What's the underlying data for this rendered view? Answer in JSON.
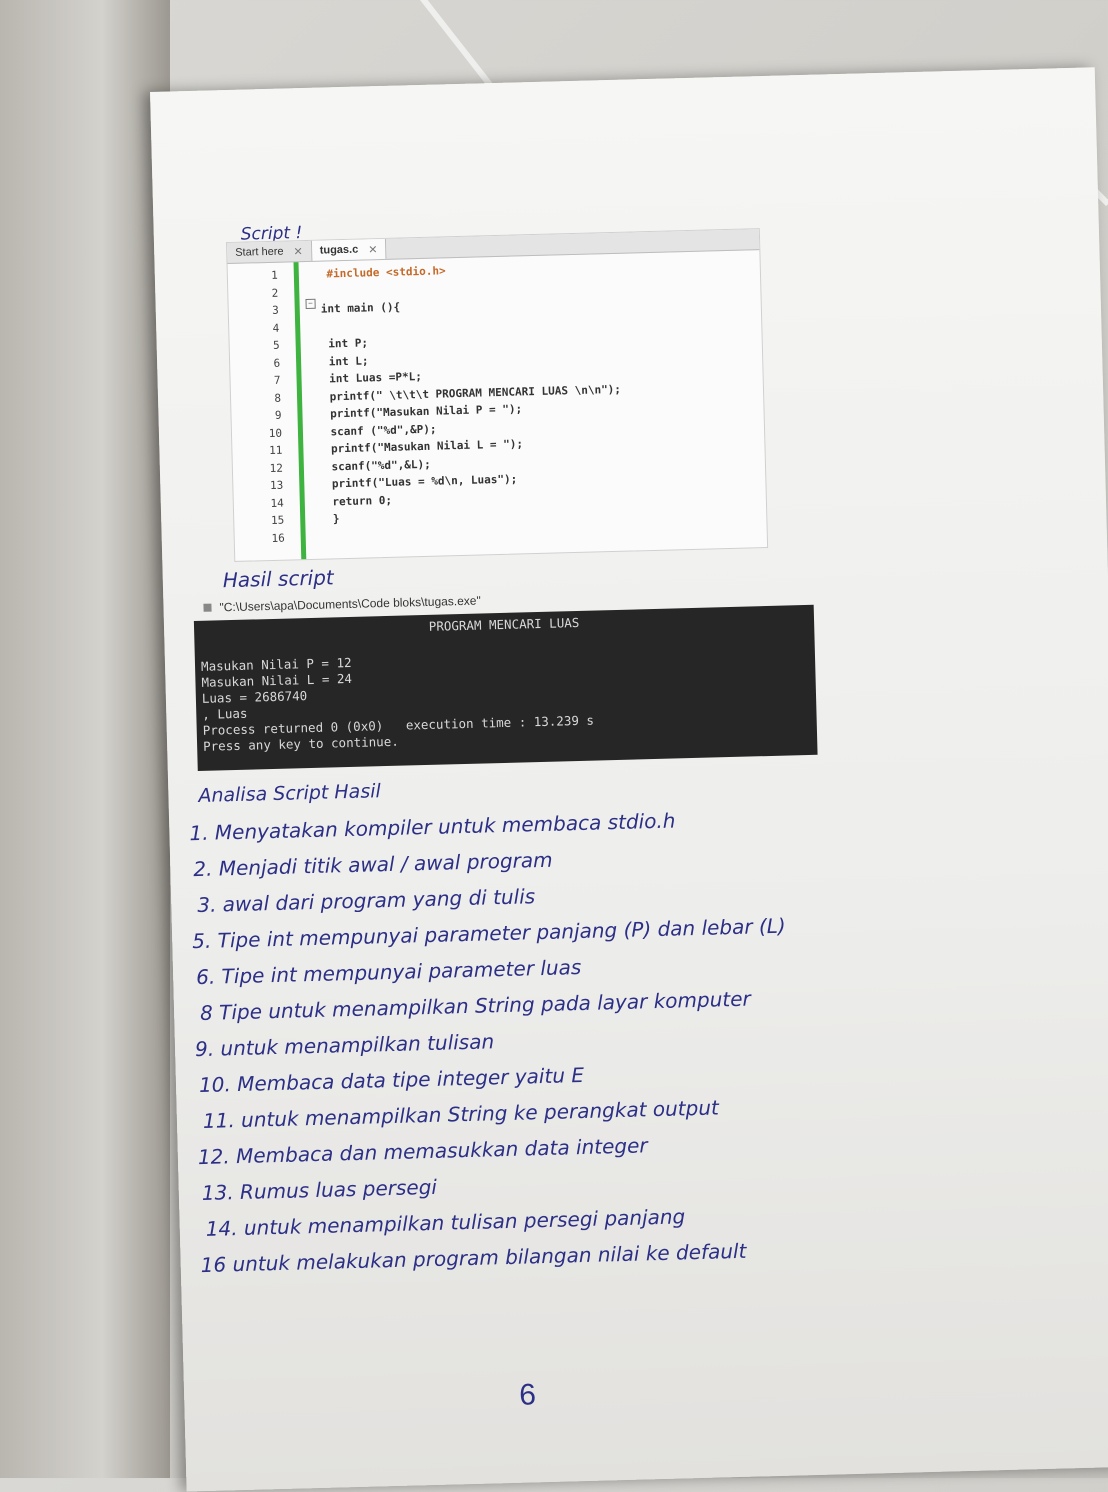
{
  "notes": {
    "script_label": "Script !",
    "hasil_label": "Hasil script",
    "analisa_label": "Analisa Script Hasil",
    "analisa_items": [
      "1. Menyatakan kompiler untuk membaca stdio.h",
      "2. Menjadi titik awal / awal program",
      "3. awal dari program yang di tulis",
      "5. Tipe int mempunyai parameter panjang (P) dan lebar (L)",
      "6. Tipe int mempunyai parameter luas",
      "8 Tipe untuk menampilkan String pada layar komputer",
      "9. untuk menampilkan tulisan",
      "10. Membaca data tipe integer yaitu E",
      "11. untuk menampilkan String ke perangkat output",
      "12. Membaca dan memasukkan data integer",
      "13. Rumus luas persegi",
      "14. untuk menampilkan tulisan persegi panjang",
      "16 untuk melakukan program bilangan nilai ke default"
    ],
    "page_number": "6"
  },
  "editor": {
    "tabs": [
      "Start here",
      "tugas.c"
    ],
    "close_glyph": "✕",
    "lines": [
      {
        "n": "1",
        "code": " #include <stdio.h>",
        "color": "#c46a2a"
      },
      {
        "n": "2",
        "code": "",
        "color": "#333333"
      },
      {
        "n": "3",
        "code": "int main (){",
        "color": "#333333"
      },
      {
        "n": "4",
        "code": "",
        "color": "#333333"
      },
      {
        "n": "5",
        "code": " int P;",
        "color": "#333333"
      },
      {
        "n": "6",
        "code": " int L;",
        "color": "#333333"
      },
      {
        "n": "7",
        "code": " int Luas =P*L;",
        "color": "#333333"
      },
      {
        "n": "8",
        "code": " printf(\" \\t\\t\\t PROGRAM MENCARI LUAS \\n\\n\");",
        "color": "#333333"
      },
      {
        "n": "9",
        "code": " printf(\"Masukan Nilai P = \");",
        "color": "#333333"
      },
      {
        "n": "10",
        "code": " scanf (\"%d\",&P);",
        "color": "#333333"
      },
      {
        "n": "11",
        "code": " printf(\"Masukan Nilai L = \");",
        "color": "#333333"
      },
      {
        "n": "12",
        "code": " scanf(\"%d\",&L);",
        "color": "#333333"
      },
      {
        "n": "13",
        "code": " printf(\"Luas = %d\\n, Luas\");",
        "color": "#333333"
      },
      {
        "n": "14",
        "code": " return 0;",
        "color": "#333333"
      },
      {
        "n": "15",
        "code": " }",
        "color": "#333333"
      },
      {
        "n": "16",
        "code": "",
        "color": "#333333"
      }
    ]
  },
  "console": {
    "title": "\"C:\\Users\\apa\\Documents\\Code bloks\\tugas.exe\"",
    "header": "PROGRAM MENCARI LUAS",
    "lines": [
      "Masukan Nilai P = 12",
      "Masukan Nilai L = 24",
      "Luas = 2686740",
      ", Luas",
      "Process returned 0 (0x0)   execution time : 13.239 s",
      "Press any key to continue."
    ]
  }
}
